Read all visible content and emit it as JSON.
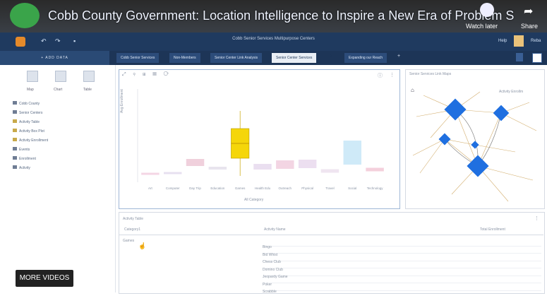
{
  "video": {
    "title": "Cobb County Government: Location Intelligence to Inspire a New Era of Problem S",
    "watch_later": "Watch later",
    "share": "Share"
  },
  "app": {
    "title": "Cobb Senior Services Multipurpose Centers",
    "help": "Help",
    "user": "Reba"
  },
  "toolbar": {
    "add_data": "+ ADD DATA"
  },
  "tabs": [
    {
      "label": "Cobb Senior Services"
    },
    {
      "label": "Non-Members"
    },
    {
      "label": "Senior Center Link Analysis"
    },
    {
      "label": "Senior Center Services"
    },
    {
      "label": "Expanding our Reach"
    }
  ],
  "sidebar": {
    "views": [
      {
        "label": "Map"
      },
      {
        "label": "Chart"
      },
      {
        "label": "Table"
      }
    ],
    "items": [
      {
        "label": "Cobb County"
      },
      {
        "label": "Senior Centers"
      },
      {
        "label": "Activity Table"
      },
      {
        "label": "Activity Box Plot"
      },
      {
        "label": "Activity Enrollment"
      },
      {
        "label": "Events"
      },
      {
        "label": "Enrollment"
      },
      {
        "label": "Activity"
      }
    ]
  },
  "chart_panel": {
    "xlabel": "All Category",
    "ylabel": "Avg Enrollment"
  },
  "chart_data": {
    "type": "box",
    "categories": [
      "Art",
      "Computer",
      "Day Trip",
      "Education",
      "Games",
      "Health Edu",
      "Outreach",
      "Physical",
      "Travel",
      "Social",
      "Technology"
    ],
    "highlight": "Games",
    "ylim": [
      0,
      200
    ]
  },
  "map_panel": {
    "title": "Senior Services Link Maps",
    "legend": "Activity Enrollm"
  },
  "table": {
    "title": "Activity Table",
    "col1": "Category1",
    "col2": "Activity Name",
    "col3": "Total Enrollment",
    "group": "Games",
    "rows": [
      "Bingo",
      "Bid Whist",
      "Chess Club",
      "Domino Club",
      "Jeopardy Game",
      "Poker",
      "Scrabble"
    ]
  },
  "overlay": {
    "more_videos": "MORE VIDEOS"
  }
}
